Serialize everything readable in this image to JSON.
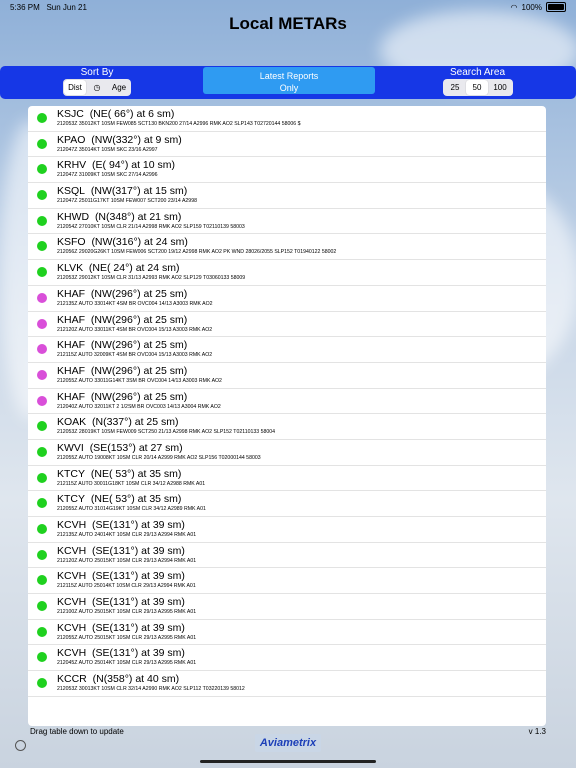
{
  "status_bar": {
    "time": "5:36 PM",
    "date": "Sun Jun 21",
    "battery": "100%"
  },
  "title": "Local METARs",
  "sort_by": {
    "label": "Sort By",
    "options": [
      "Dist",
      "Age"
    ],
    "selected": "Dist"
  },
  "latest_button": {
    "line1": "Latest Reports",
    "line2": "Only"
  },
  "search_area": {
    "label": "Search Area",
    "options": [
      "25",
      "50",
      "100"
    ],
    "selected": "50"
  },
  "colors": {
    "green": "#1fd11f",
    "magenta": "#d94fd9",
    "bar": "#1637e6",
    "accent": "#2f9bf2"
  },
  "reports": [
    {
      "station": "KSJC",
      "dir": "(NE( 66°) at   6 sm)",
      "raw": "212053Z 35012KT 10SM FEW085 SCT130 BKN200 27/14 A2996 RMK AO2 SLP143 T02720144 58006 $",
      "color": "green"
    },
    {
      "station": "KPAO",
      "dir": "(NW(332°) at   9 sm)",
      "raw": "212047Z 35014KT 10SM SKC 23/16 A2997",
      "color": "green"
    },
    {
      "station": "KRHV",
      "dir": "(E( 94°) at  10 sm)",
      "raw": "212047Z 31009KT 10SM SKC 27/14 A2996",
      "color": "green"
    },
    {
      "station": "KSQL",
      "dir": "(NW(317°) at  15 sm)",
      "raw": "212047Z 25011G17KT 10SM FEW007 SCT200 23/14 A2998",
      "color": "green"
    },
    {
      "station": "KHWD",
      "dir": "(N(348°) at  21 sm)",
      "raw": "212054Z 27010KT 10SM CLR 21/14 A2998 RMK AO2 SLP159 T02110139 58003",
      "color": "green"
    },
    {
      "station": "KSFO",
      "dir": "(NW(316°) at  24 sm)",
      "raw": "212056Z 29020G26KT 10SM FEW006 SCT200 19/12 A2998 RMK AO2 PK WND 28026/2055 SLP152 T01940122 58002",
      "color": "green"
    },
    {
      "station": "KLVK",
      "dir": "(NE( 24°) at  24 sm)",
      "raw": "212053Z 29012KT 10SM CLR 31/13 A2993 RMK AO2 SLP129 T03060133 58009",
      "color": "green"
    },
    {
      "station": "KHAF",
      "dir": "(NW(296°) at  25 sm)",
      "raw": "212135Z AUTO 33014KT 4SM BR OVC004 14/13 A3003 RMK AO2",
      "color": "magenta"
    },
    {
      "station": "KHAF",
      "dir": "(NW(296°) at  25 sm)",
      "raw": "212120Z AUTO 33011KT 4SM BR OVC004 15/13 A3003 RMK AO2",
      "color": "magenta"
    },
    {
      "station": "KHAF",
      "dir": "(NW(296°) at  25 sm)",
      "raw": "212115Z AUTO 32009KT 4SM BR OVC004 15/13 A3003 RMK AO2",
      "color": "magenta"
    },
    {
      "station": "KHAF",
      "dir": "(NW(296°) at  25 sm)",
      "raw": "212055Z AUTO 33011G14KT 3SM BR OVC004 14/13 A3003 RMK AO2",
      "color": "magenta"
    },
    {
      "station": "KHAF",
      "dir": "(NW(296°) at  25 sm)",
      "raw": "212040Z AUTO 32011KT 2 1/2SM BR OVC003 14/13 A3004 RMK AO2",
      "color": "magenta"
    },
    {
      "station": "KOAK",
      "dir": "(N(337°) at  25 sm)",
      "raw": "212053Z 28019KT 10SM FEW009 SCT250 21/13 A2998 RMK AO2 SLP152 T02110133 58004",
      "color": "green"
    },
    {
      "station": "KWVI",
      "dir": "(SE(153°) at  27 sm)",
      "raw": "212055Z AUTO 19008KT 10SM CLR 20/14 A2999 RMK AO2 SLP156 T02000144 58003",
      "color": "green"
    },
    {
      "station": "KTCY",
      "dir": "(NE( 53°) at  35 sm)",
      "raw": "212115Z AUTO 30011G18KT 10SM CLR 34/12 A2988 RMK A01",
      "color": "green"
    },
    {
      "station": "KTCY",
      "dir": "(NE( 53°) at  35 sm)",
      "raw": "212055Z AUTO 31014G19KT 10SM CLR 34/12 A2989 RMK A01",
      "color": "green"
    },
    {
      "station": "KCVH",
      "dir": "(SE(131°) at  39 sm)",
      "raw": "212135Z AUTO 24014KT 10SM CLR 29/13 A2994 RMK A01",
      "color": "green"
    },
    {
      "station": "KCVH",
      "dir": "(SE(131°) at  39 sm)",
      "raw": "212120Z AUTO 25015KT 10SM CLR 29/13 A2994 RMK A01",
      "color": "green"
    },
    {
      "station": "KCVH",
      "dir": "(SE(131°) at  39 sm)",
      "raw": "212115Z AUTO 25014KT 10SM CLR 29/13 A2994 RMK A01",
      "color": "green"
    },
    {
      "station": "KCVH",
      "dir": "(SE(131°) at  39 sm)",
      "raw": "212100Z AUTO 25015KT 10SM CLR 29/13 A2995 RMK A01",
      "color": "green"
    },
    {
      "station": "KCVH",
      "dir": "(SE(131°) at  39 sm)",
      "raw": "212055Z AUTO 25015KT 10SM CLR 29/13 A2995 RMK A01",
      "color": "green"
    },
    {
      "station": "KCVH",
      "dir": "(SE(131°) at  39 sm)",
      "raw": "212045Z AUTO 25014KT 10SM CLR 29/13 A2995 RMK A01",
      "color": "green"
    },
    {
      "station": "KCCR",
      "dir": "(N(358°) at  40 sm)",
      "raw": "212053Z 30013KT 10SM CLR 32/14 A2990 RMK AO2 SLP112 T03220139 58012",
      "color": "green"
    }
  ],
  "footer": {
    "hint": "Drag table down to update",
    "version": "v 1.3",
    "logo": "Aviametrix"
  }
}
